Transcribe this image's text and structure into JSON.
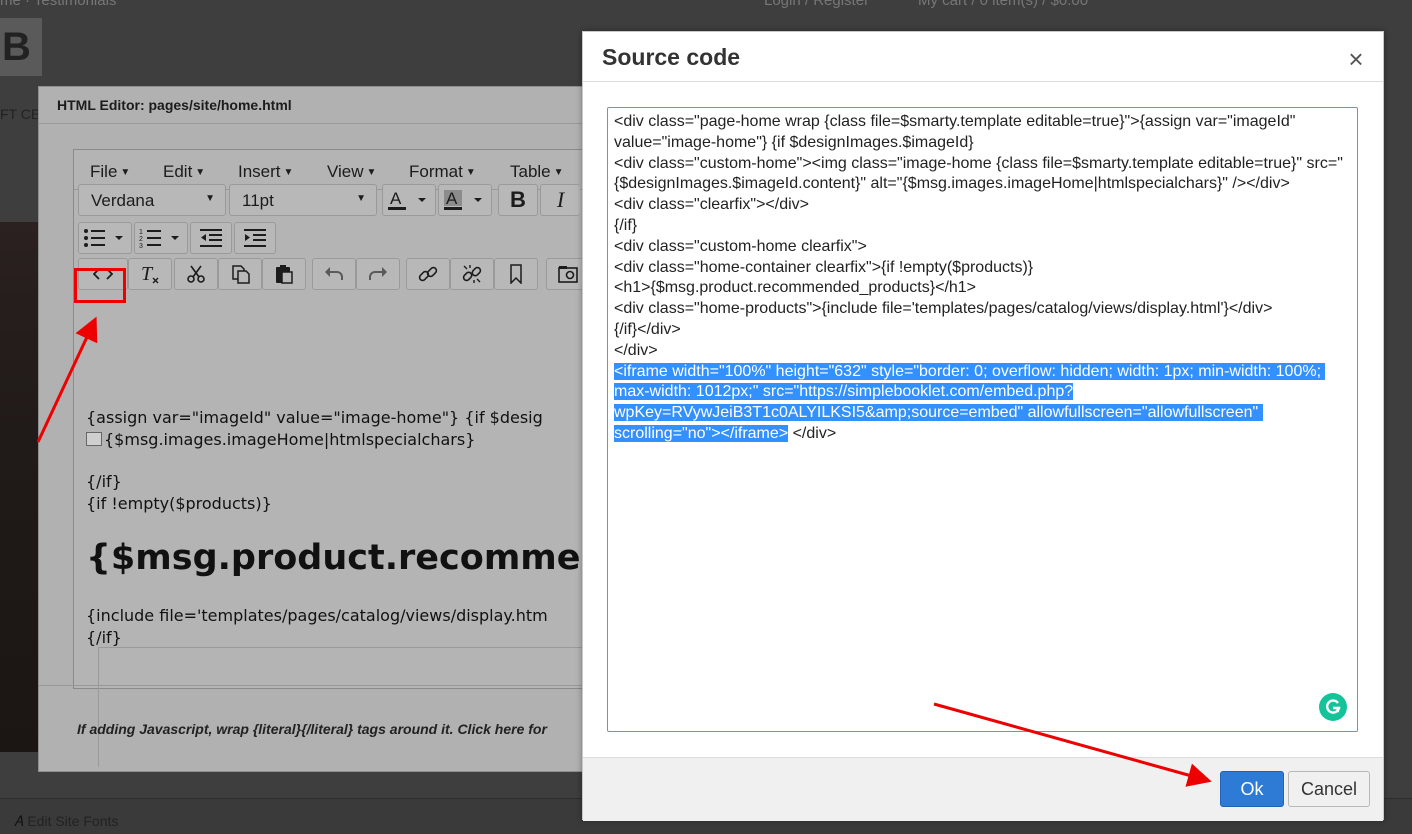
{
  "background": {
    "top_links": [
      "me · Testimonials",
      "Login / Register",
      "My cart / 0 item(s) / $0.00"
    ],
    "logo_letter": "B",
    "nav_fragment": "FT CE",
    "footer_label": "Edit Site Fonts"
  },
  "editor": {
    "title": "HTML Editor: pages/site/home.html",
    "menus": [
      "File",
      "Edit",
      "Insert",
      "View",
      "Format",
      "Table"
    ],
    "font_family": "Verdana",
    "font_size": "11pt",
    "content": {
      "line1": "{assign var=\"imageId\" value=\"image-home\"} {if $desig",
      "line2": "{$msg.images.imageHome|htmlspecialchars}",
      "line3": "{/if}",
      "line4": "{if !empty($products)}",
      "heading": "{$msg.product.recommen",
      "line5": "{include file='templates/pages/catalog/views/display.htm",
      "line6": "{/if}"
    },
    "hint": "If adding Javascript, wrap {literal}{/literal} tags around it. Click here for"
  },
  "modal": {
    "title": "Source code",
    "close_glyph": "×",
    "code_plain": "<div class=\"page-home wrap {class file=$smarty.template editable=true}\">{assign var=\"imageId\" value=\"image-home\"} {if $designImages.$imageId}\n<div class=\"custom-home\"><img class=\"image-home {class file=$smarty.template editable=true}\" src=\"{$designImages.$imageId.content}\" alt=\"{$msg.images.imageHome|htmlspecialchars}\" /></div>\n<div class=\"clearfix\"></div>\n{/if}\n<div class=\"custom-home clearfix\">\n<div class=\"home-container clearfix\">{if !empty($products)}\n<h1>{$msg.product.recommended_products}</h1>\n<div class=\"home-products\">{include file='templates/pages/catalog/views/display.html'}</div>\n{/if}</div>\n</div>\n",
    "code_selected": "<iframe width=\"100%\" height=\"632\" style=\"border: 0; overflow: hidden; width: 1px; min-width: 100%; max-width: 1012px;\" src=\"https://simplebooklet.com/embed.php?wpKey=RVywJeiB3T1c0ALYILKSI5&amp;source=embed\" allowfullscreen=\"allowfullscreen\" scrolling=\"no\"></iframe>",
    "code_after": "</div>",
    "ok_label": "Ok",
    "cancel_label": "Cancel"
  },
  "colors": {
    "accent": "#2e7bd6",
    "selection": "#3390ff",
    "annotation": "#e00000",
    "grammarly": "#15c39a"
  }
}
